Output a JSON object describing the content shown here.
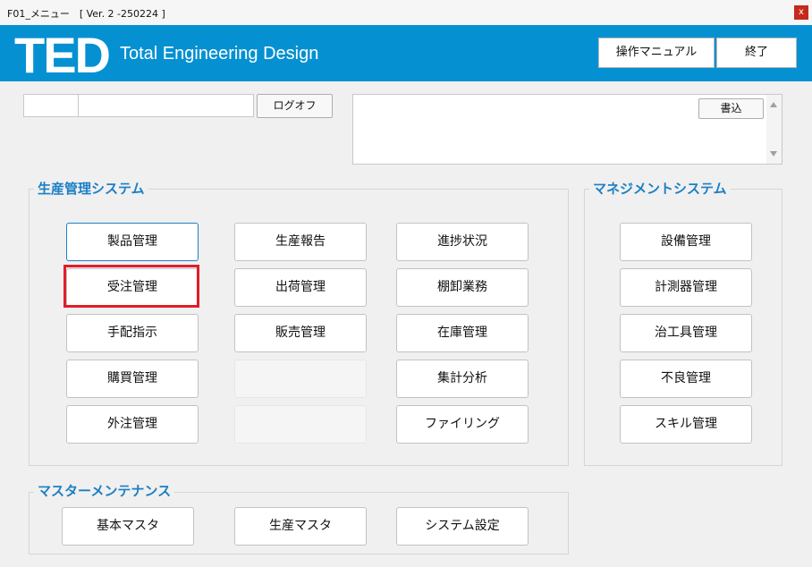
{
  "window": {
    "title": "F01_メニュー　[ Ver. 2 -250224 ]",
    "close_label": "x"
  },
  "header": {
    "logo": "TED",
    "subtitle": "Total Engineering Design",
    "manual_label": "操作マニュアル",
    "exit_label": "終了"
  },
  "login": {
    "user_code": "",
    "user_name": "",
    "logoff_label": "ログオフ"
  },
  "notes": {
    "text": "",
    "write_label": "書込"
  },
  "production": {
    "title": "生産管理システム",
    "col1": [
      "製品管理",
      "受注管理",
      "手配指示",
      "購買管理",
      "外注管理"
    ],
    "col2": [
      "生産報告",
      "出荷管理",
      "販売管理",
      "",
      ""
    ],
    "col3": [
      "進捗状況",
      "棚卸業務",
      "在庫管理",
      "集計分析",
      "ファイリング"
    ]
  },
  "management": {
    "title": "マネジメントシステム",
    "items": [
      "設備管理",
      "計測器管理",
      "治工具管理",
      "不良管理",
      "スキル管理"
    ]
  },
  "master": {
    "title": "マスターメンテナンス",
    "items": [
      "基本マスタ",
      "生産マスタ",
      "システム設定"
    ]
  },
  "colors": {
    "header": "#0591d1",
    "group_title": "#1b7fc4",
    "highlight": "#e11d2a",
    "focus": "#1e7fc6"
  }
}
